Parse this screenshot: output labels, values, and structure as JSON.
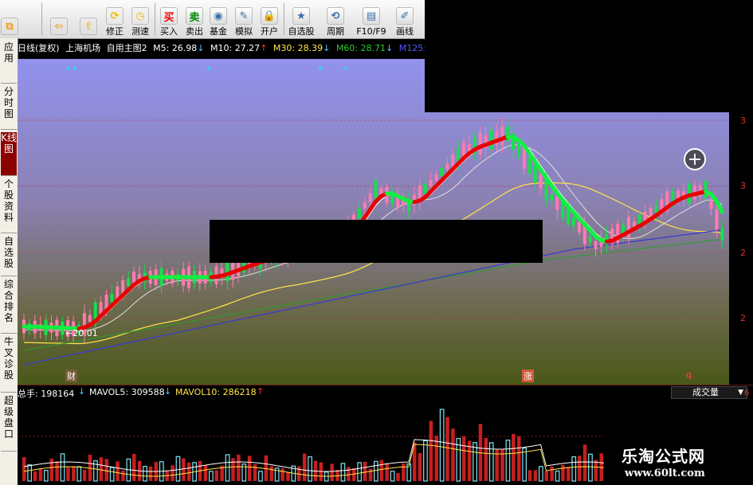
{
  "toolbar": {
    "items": [
      {
        "label": "",
        "icon": "window-plus-icon"
      },
      {
        "label": "",
        "icon": "back-arrow-icon"
      },
      {
        "label": "",
        "icon": "up-arrow-icon"
      },
      {
        "label": "修正",
        "icon": "revise-icon"
      },
      {
        "label": "测速",
        "icon": "speed-clock-icon"
      },
      {
        "label": "买入",
        "icon": "buy-icon",
        "glyph": "买"
      },
      {
        "label": "卖出",
        "icon": "sell-icon",
        "glyph": "卖"
      },
      {
        "label": "基金",
        "icon": "fund-icon"
      },
      {
        "label": "模拟",
        "icon": "hammer-icon"
      },
      {
        "label": "开户",
        "icon": "lock-icon"
      },
      {
        "label": "自选股",
        "icon": "star-folder-icon"
      },
      {
        "label": "周期",
        "icon": "cycle-icon"
      },
      {
        "label": "F10/F9",
        "icon": "f10-icon"
      },
      {
        "label": "画线",
        "icon": "pen-icon"
      }
    ]
  },
  "sidebar": {
    "tabs": [
      {
        "label": "应用"
      },
      {
        "label": "分时图"
      },
      {
        "label": "K线图",
        "active": true
      },
      {
        "label": "个股资料"
      },
      {
        "label": "自选股"
      },
      {
        "label": "综合排名"
      },
      {
        "label": "牛叉诊股"
      },
      {
        "label": "超级盘口"
      }
    ]
  },
  "price_legend": {
    "period": "日线(复权)",
    "stock": "上海机场",
    "formula": "自用主图2",
    "m5": "M5: 26.98",
    "m10": "M10: 27.27",
    "m30": "M30: 28.39",
    "m60": "M60: 28.71",
    "m125": "M125: 2"
  },
  "volume_legend": {
    "total": "总手: 198164",
    "mavol5": "MAVOL5: 309588",
    "mavol10": "MAVOL10: 286218",
    "dropdown_label": "成交量",
    "right_axis_partial": "6"
  },
  "price_axis": {
    "labels": [
      "3",
      "3",
      "2",
      "2"
    ]
  },
  "annotations": {
    "low_price": "20.01",
    "event_cai": "财",
    "event_zhang": "涨",
    "event_q": "q"
  },
  "watermark": {
    "title": "乐淘公式网",
    "url": "www.60lt.com"
  },
  "colors": {
    "bg_top": "#8e8ee6",
    "bg_bottom": "#4a5a18",
    "up": "#ff7ab0",
    "down": "#17e04a",
    "ribbon_red": "#e80000",
    "ribbon_green": "#10f040",
    "ma_white": "#ffffff",
    "ma_yellow": "#ffe64a",
    "ma_green": "#28a028",
    "ma_blue": "#3b3bd0",
    "vol_up": "#c81e1e",
    "vol_down": "#7fe6f2"
  }
}
